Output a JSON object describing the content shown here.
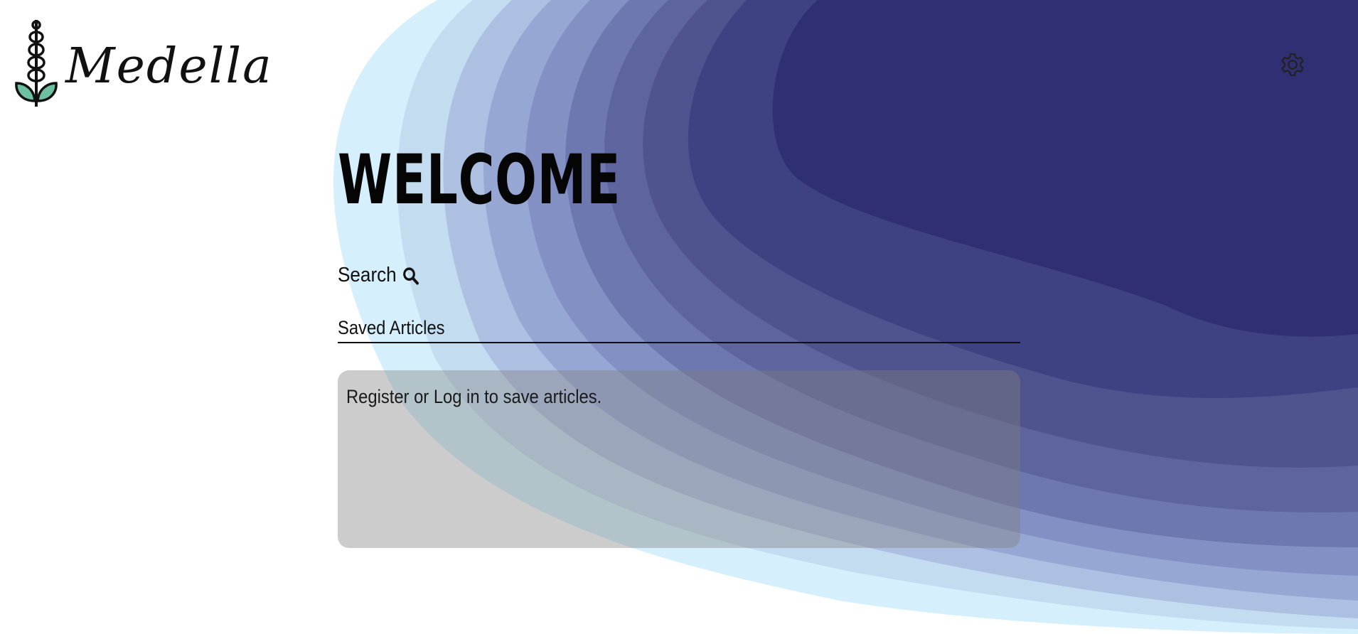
{
  "brand": {
    "name": "Medella"
  },
  "header": {
    "settings_icon": "gear-icon"
  },
  "main": {
    "title": "WELCOME",
    "search": {
      "label": "Search",
      "icon": "search-icon"
    },
    "saved_articles": {
      "heading": "Saved Articles",
      "message": {
        "register": "Register",
        "or": " or ",
        "login": "Log in",
        "suffix": " to save articles."
      }
    }
  },
  "colors": {
    "accent_dark": "#312f73",
    "accent_light": "#d5f0fc",
    "panel": "rgba(128,128,128,0.4)",
    "leaf": "#6fbfa3"
  }
}
